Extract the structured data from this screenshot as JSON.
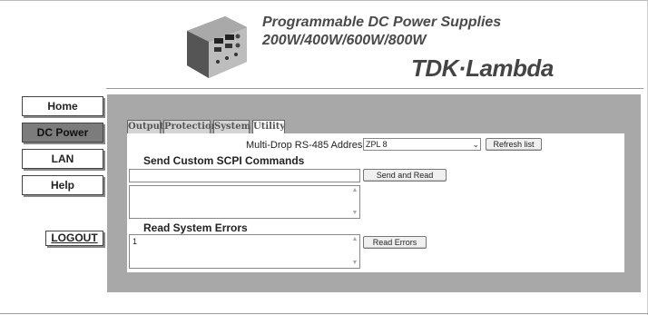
{
  "header": {
    "title_line1": "Programmable DC Power Supplies",
    "title_line2": "200W/400W/600W/800W",
    "brand": "TDK·Lambda"
  },
  "sidebar": {
    "items": [
      {
        "label": "Home"
      },
      {
        "label": "DC Power"
      },
      {
        "label": "LAN"
      },
      {
        "label": "Help"
      }
    ],
    "logout_label": "LOGOUT"
  },
  "tabs": [
    {
      "label": "Output"
    },
    {
      "label": "Protection"
    },
    {
      "label": "System"
    },
    {
      "label": "Utility"
    }
  ],
  "utility": {
    "address_label": "Multi-Drop RS-485 Address",
    "address_value": "ZPL 8",
    "refresh_label": "Refresh list",
    "scpi_heading": "Send Custom SCPI Commands",
    "scpi_input_value": "",
    "send_label": "Send and Read",
    "scpi_response": "",
    "errors_heading": "Read System Errors",
    "errors_value": "1",
    "read_errors_label": "Read Errors"
  },
  "colors": {
    "panel_bg": "#a8a8a8",
    "active_nav": "#7c7c7c"
  }
}
